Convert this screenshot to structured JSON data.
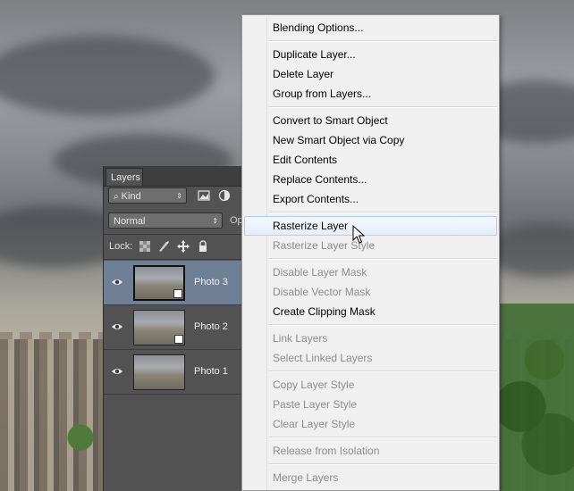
{
  "layers_panel": {
    "tab": "Layers",
    "filter": {
      "kind": "Kind"
    },
    "blend_mode": "Normal",
    "opacity_label": "Op",
    "lock_label": "Lock:",
    "layers": [
      {
        "name": "Photo 3",
        "selected": true,
        "visible": true
      },
      {
        "name": "Photo 2",
        "selected": false,
        "visible": true
      },
      {
        "name": "Photo 1",
        "selected": false,
        "visible": true
      }
    ]
  },
  "context_menu": {
    "items": [
      {
        "label": "Blending Options...",
        "enabled": true
      },
      {
        "label": "Duplicate Layer...",
        "enabled": true
      },
      {
        "label": "Delete Layer",
        "enabled": true
      },
      {
        "label": "Group from Layers...",
        "enabled": true
      },
      {
        "label": "Convert to Smart Object",
        "enabled": true
      },
      {
        "label": "New Smart Object via Copy",
        "enabled": true
      },
      {
        "label": "Edit Contents",
        "enabled": true
      },
      {
        "label": "Replace Contents...",
        "enabled": true
      },
      {
        "label": "Export Contents...",
        "enabled": true
      },
      {
        "label": "Rasterize Layer",
        "enabled": true,
        "hovered": true
      },
      {
        "label": "Rasterize Layer Style",
        "enabled": false
      },
      {
        "label": "Disable Layer Mask",
        "enabled": false
      },
      {
        "label": "Disable Vector Mask",
        "enabled": false
      },
      {
        "label": "Create Clipping Mask",
        "enabled": true
      },
      {
        "label": "Link Layers",
        "enabled": false
      },
      {
        "label": "Select Linked Layers",
        "enabled": false
      },
      {
        "label": "Copy Layer Style",
        "enabled": false
      },
      {
        "label": "Paste Layer Style",
        "enabled": false
      },
      {
        "label": "Clear Layer Style",
        "enabled": false
      },
      {
        "label": "Release from Isolation",
        "enabled": false
      },
      {
        "label": "Merge Layers",
        "enabled": false
      }
    ]
  },
  "colors": {
    "menu_bg": "#f0f0f0",
    "menu_hover": "#e4eefa",
    "panel_bg": "#535353",
    "selected_layer": "#6f7f96"
  }
}
